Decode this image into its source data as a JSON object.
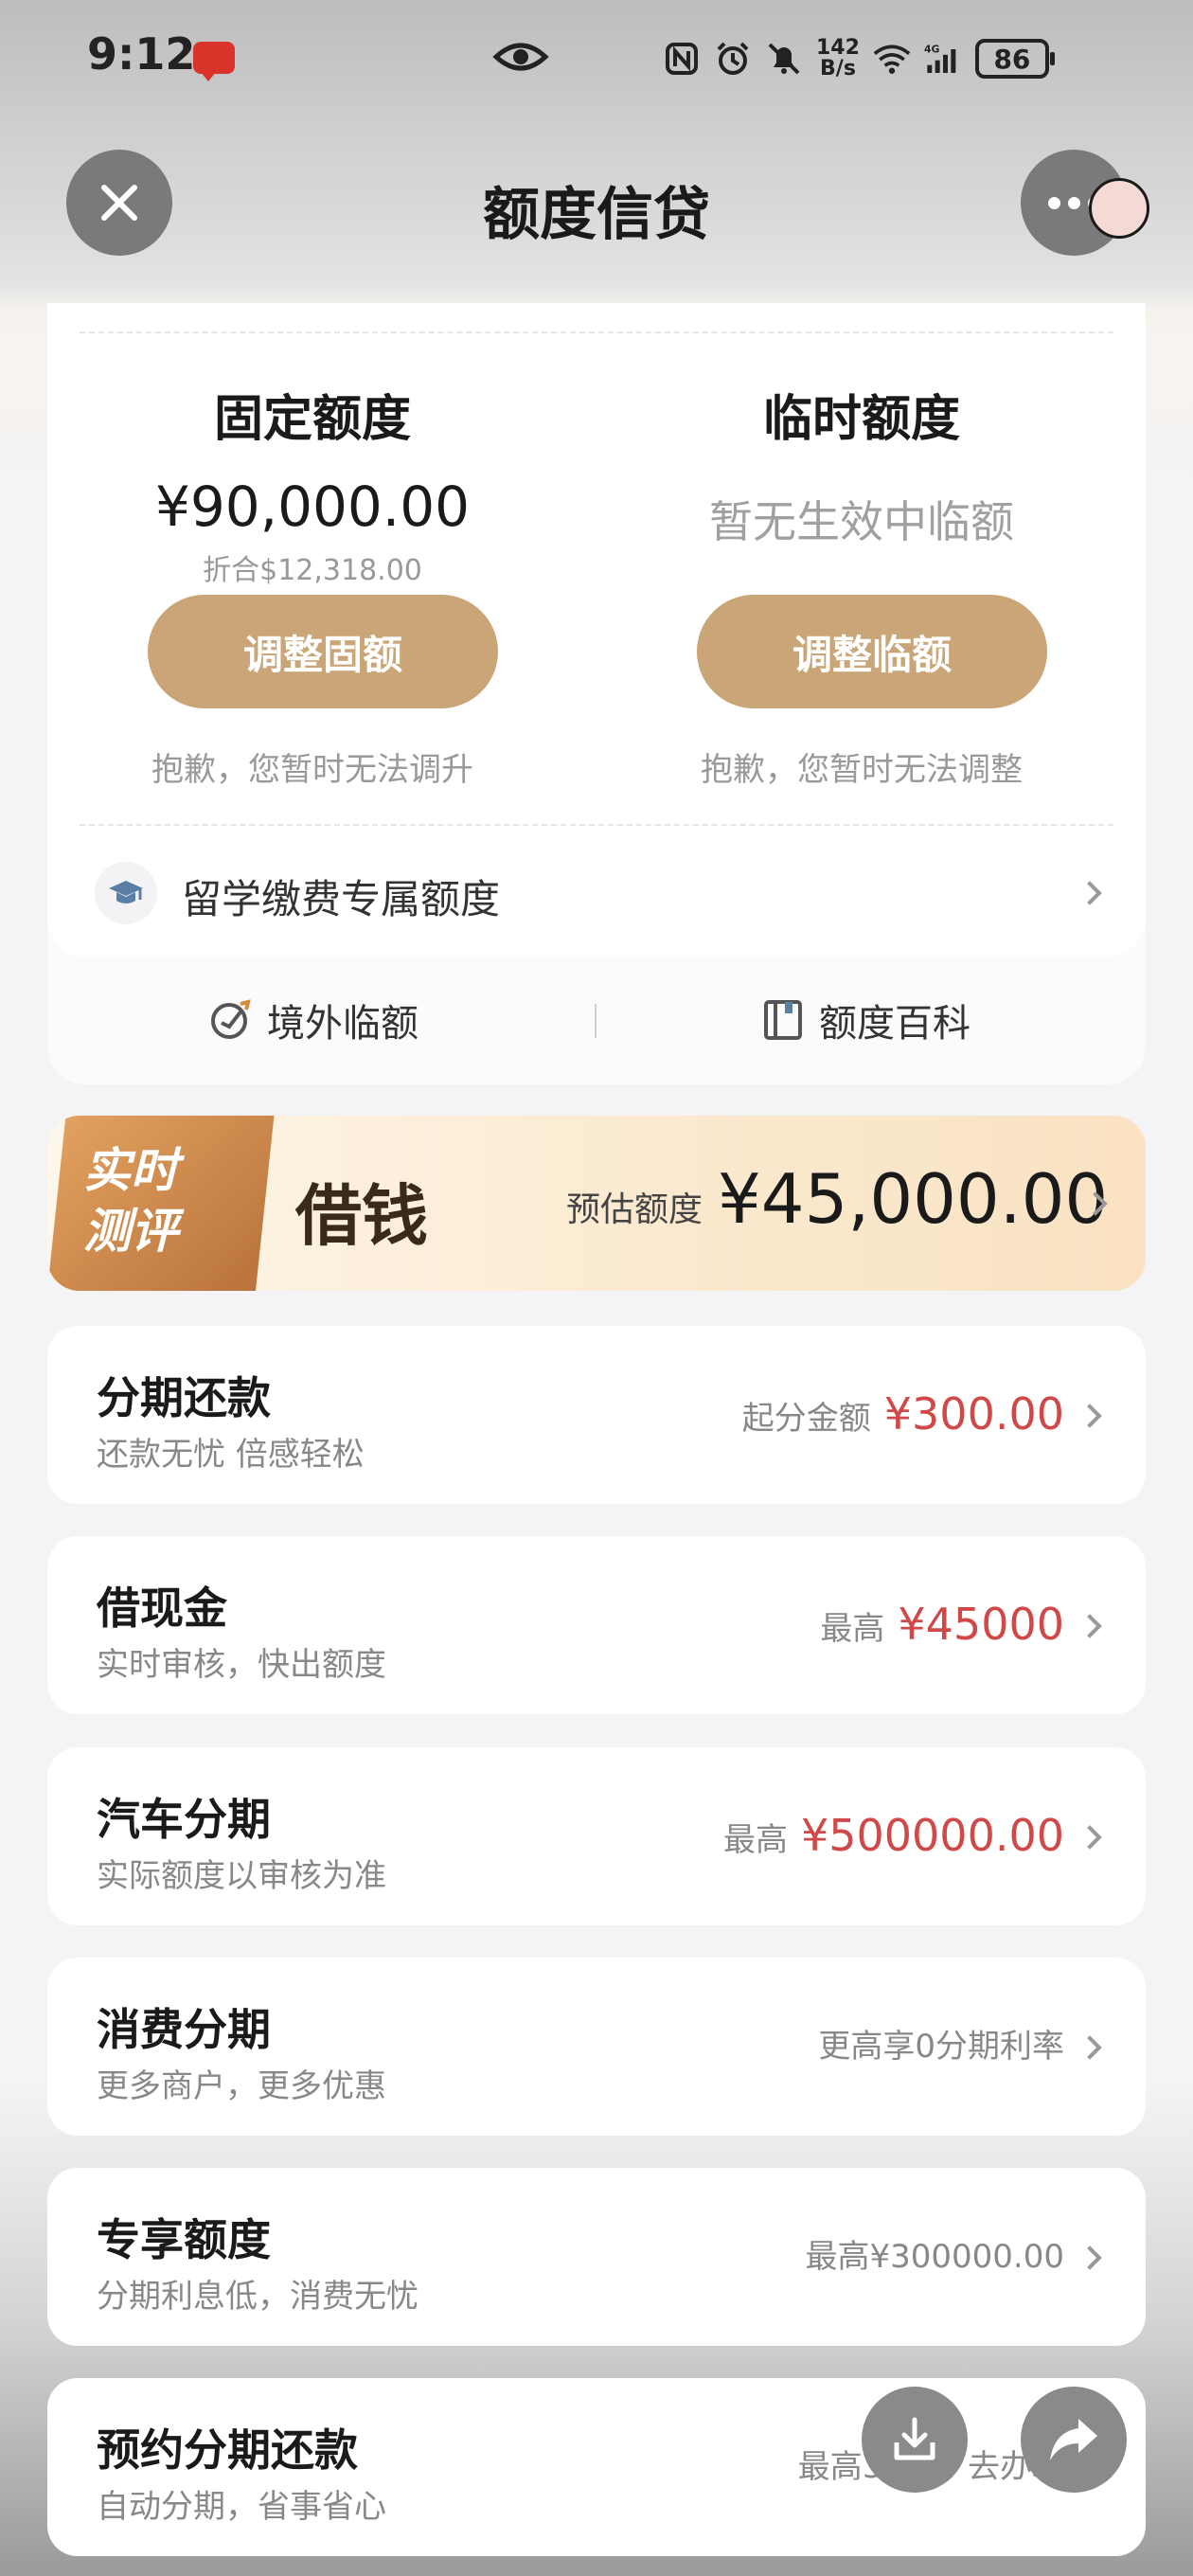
{
  "status_bar": {
    "time": "9:12",
    "speed_value": "142",
    "speed_unit": "B/s",
    "network_label": "4G",
    "battery": "86"
  },
  "nav": {
    "title": "额度信贷"
  },
  "limits": {
    "fixed": {
      "title": "固定额度",
      "amount": "¥90,000.00",
      "converted": "折合$12,318.00",
      "button_label": "调整固额",
      "tip": "抱歉，您暂时无法调升"
    },
    "temporary": {
      "title": "临时额度",
      "status": "暂无生效中临额",
      "button_label": "调整临额",
      "tip": "抱歉，您暂时无法调整"
    },
    "study_abroad": {
      "label": "留学缴费专属额度"
    },
    "links": {
      "overseas": "境外临额",
      "encyclopedia": "额度百科"
    }
  },
  "loan_banner": {
    "tag": "实时测评",
    "tag_line1": "实时",
    "tag_line2": "测评",
    "title": "借钱",
    "estimate_label": "预估额度",
    "estimate_amount": "¥45,000.00"
  },
  "products": [
    {
      "title": "分期还款",
      "subtitle": "还款无忧 倍感轻松",
      "prefix": "起分金额",
      "value": "¥300.00"
    },
    {
      "title": "借现金",
      "subtitle": "实时审核，快出额度",
      "prefix": "最高",
      "value": "¥45000"
    },
    {
      "title": "汽车分期",
      "subtitle": "实际额度以审核为准",
      "prefix": "最高",
      "value": "¥500000.00"
    },
    {
      "title": "消费分期",
      "subtitle": "更多商户，更多优惠",
      "plain": "更高享0分期利率"
    },
    {
      "title": "专享额度",
      "subtitle": "分期利息低，消费无忧",
      "plain": "最高¥300000.00"
    },
    {
      "title": "预约分期还款",
      "subtitle": "自动分期，省事省心",
      "plain": "最高36期，去办理"
    }
  ],
  "colors": {
    "accent_gold": "#c9a577",
    "price_red": "#d04848"
  },
  "icons": {
    "close": "close-icon",
    "more": "more-dots-icon",
    "study": "graduation-cap-icon",
    "overseas": "globe-plane-icon",
    "encyclopedia": "book-icon",
    "download": "download-icon",
    "share": "share-arrow-icon"
  }
}
